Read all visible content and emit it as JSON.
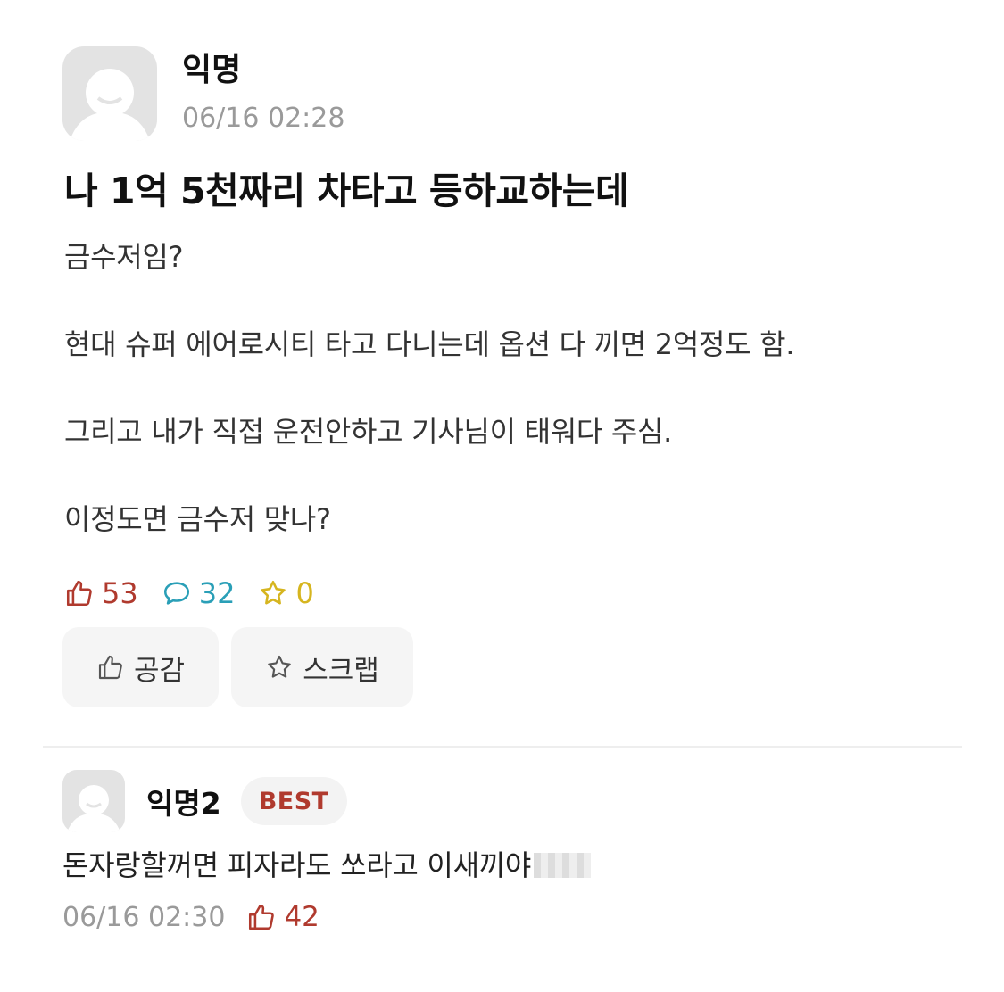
{
  "post": {
    "author": "익명",
    "time": "06/16 02:28",
    "title": "나 1억 5천짜리 차타고 등하교하는데",
    "body": [
      "금수저임?",
      "현대 슈퍼 에어로시티 타고 다니는데 옵션 다 끼면 2억정도 함.",
      "그리고 내가 직접 운전안하고 기사님이 태워다 주심.",
      "이정도면 금수저 맞나?"
    ],
    "stats": {
      "likes": "53",
      "comments": "32",
      "scraps": "0"
    },
    "actions": {
      "like_label": "공감",
      "scrap_label": "스크랩"
    }
  },
  "comment": {
    "author": "익명2",
    "badge": "BEST",
    "text": "돈자랑할꺼면 피자라도 쏘라고 이새끼야",
    "time": "06/16 02:30",
    "likes": "42"
  },
  "colors": {
    "like": "#b03a2e",
    "comment": "#2a9fb7",
    "scrap": "#d6b51f",
    "muted": "#9a9a9a"
  },
  "icons": [
    "avatar-placeholder-icon",
    "thumbs-up-icon",
    "speech-bubble-icon",
    "star-icon"
  ]
}
